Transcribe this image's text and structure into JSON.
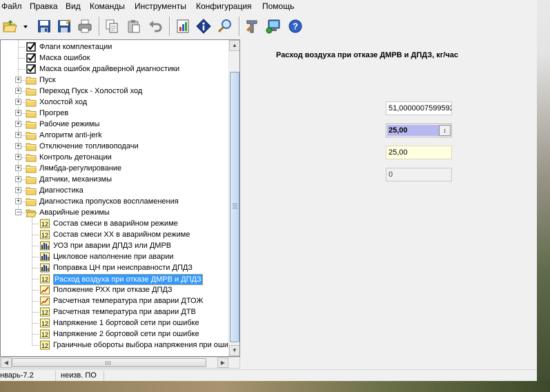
{
  "menu": [
    "Файл",
    "Правка",
    "Вид",
    "Команды",
    "Инструменты",
    "Конфигурация",
    "Помощь"
  ],
  "toolbar": {
    "buttons": [
      "open-icon",
      "dropdown-arrow-icon",
      "save-icon",
      "save-as-icon",
      "print-icon",
      "copy-icon",
      "paste-icon",
      "undo-icon",
      "chart-icon",
      "info-icon",
      "search-icon",
      "tools-icon",
      "network-icon",
      "help-icon"
    ]
  },
  "tree": {
    "items": [
      {
        "label": "Флаги комплектации",
        "icon": "checkbox-checked"
      },
      {
        "label": "Маска ошибок",
        "icon": "checkbox-checked"
      },
      {
        "label": "Маска ошибок драйверной диагностики",
        "icon": "checkbox-checked"
      },
      {
        "label": "Пуск",
        "icon": "folder",
        "expander": "+"
      },
      {
        "label": "Переход Пуск - Холостой ход",
        "icon": "folder",
        "expander": "+"
      },
      {
        "label": "Холостой ход",
        "icon": "folder",
        "expander": "+"
      },
      {
        "label": "Прогрев",
        "icon": "folder",
        "expander": "+"
      },
      {
        "label": "Рабочие режимы",
        "icon": "folder",
        "expander": "+"
      },
      {
        "label": "Алгоритм anti-jerk",
        "icon": "folder",
        "expander": "+"
      },
      {
        "label": "Отключение топливоподачи",
        "icon": "folder",
        "expander": "+"
      },
      {
        "label": "Контроль детонации",
        "icon": "folder",
        "expander": "+"
      },
      {
        "label": "Лямбда-регулирование",
        "icon": "folder",
        "expander": "+"
      },
      {
        "label": "Датчики, механизмы",
        "icon": "folder",
        "expander": "+"
      },
      {
        "label": "Диагностика",
        "icon": "folder",
        "expander": "+"
      },
      {
        "label": "Диагностика пропусков воспламенения",
        "icon": "folder",
        "expander": "+"
      },
      {
        "label": "Аварийные режимы",
        "icon": "folder-open",
        "expander": "−"
      },
      {
        "label": "Состав смеси в аварийном режиме",
        "icon": "scalar",
        "child": true
      },
      {
        "label": "Состав смеси ХХ в аварийном режиме",
        "icon": "scalar",
        "child": true
      },
      {
        "label": "УОЗ при аварии ДПДЗ или ДМРВ",
        "icon": "table",
        "child": true
      },
      {
        "label": "Цикловое наполнение при аварии",
        "icon": "table",
        "child": true
      },
      {
        "label": "Поправка ЦН при неисправности ДПДЗ",
        "icon": "table",
        "child": true
      },
      {
        "label": "Расход воздуха при отказе ДМРВ и ДПДЗ",
        "icon": "scalar",
        "child": true,
        "selected": true
      },
      {
        "label": "Положение РХХ при отказе ДПДЗ",
        "icon": "graph",
        "child": true
      },
      {
        "label": "Расчетная температура при аварии ДТОЖ",
        "icon": "graph",
        "child": true
      },
      {
        "label": "Расчетная температура при аварии ДТВ",
        "icon": "scalar",
        "child": true
      },
      {
        "label": "Напряжение 1 бортовой сети при ошибке",
        "icon": "scalar",
        "child": true
      },
      {
        "label": "Напряжение 2 бортовой сети при ошибке",
        "icon": "scalar",
        "child": true
      },
      {
        "label": "Граничные обороты выбора напряжения при оши",
        "icon": "scalar",
        "child": true
      }
    ]
  },
  "icons": {
    "scalar_text": "12"
  },
  "param": {
    "title": "Расход воздуха при отказе ДМРВ и ДПДЗ, кг/час",
    "raw_value": "51,0000007599592",
    "edit_value": "25,00",
    "result_value": "25,00",
    "zero_value": "0"
  },
  "status": {
    "firmware": "нварь-7.2",
    "so": "неизв. ПО"
  },
  "colors": {
    "selection": "#3399ff",
    "edit_highlight": "#b8b8f0",
    "result_bg": "#ffffe0"
  }
}
